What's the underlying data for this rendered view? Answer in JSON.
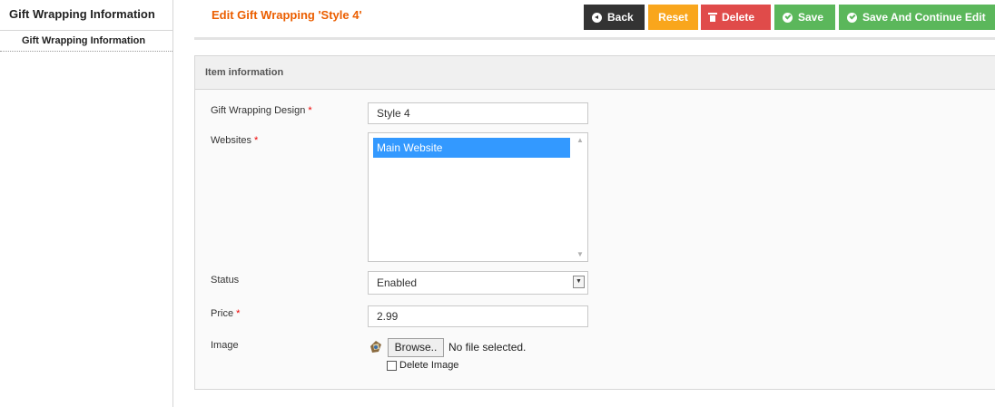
{
  "sidebar": {
    "title": "Gift Wrapping Information",
    "tabs": [
      {
        "label": "Gift Wrapping Information"
      }
    ]
  },
  "header": {
    "title": "Edit Gift Wrapping 'Style 4'",
    "buttons": {
      "back": "Back",
      "reset": "Reset",
      "delete": "Delete",
      "save": "Save",
      "save_continue": "Save And Continue Edit"
    }
  },
  "panel": {
    "title": "Item information",
    "fields": {
      "design": {
        "label": "Gift Wrapping Design",
        "value": "Style 4",
        "required": "*"
      },
      "websites": {
        "label": "Websites",
        "required": "*",
        "options": [
          {
            "label": "Main Website",
            "selected": true
          }
        ]
      },
      "status": {
        "label": "Status",
        "value": "Enabled"
      },
      "price": {
        "label": "Price",
        "value": "2.99",
        "required": "*"
      },
      "image": {
        "label": "Image",
        "browse": "Browse..",
        "file_status": "No file selected.",
        "delete_label": "Delete Image"
      }
    }
  },
  "colors": {
    "title_orange": "#eb5e00",
    "back": "#333333",
    "reset": "#f9a61c",
    "delete": "#e04b4a",
    "save": "#5bb75b",
    "selected_option": "#3399ff",
    "required": "#ee0000"
  }
}
